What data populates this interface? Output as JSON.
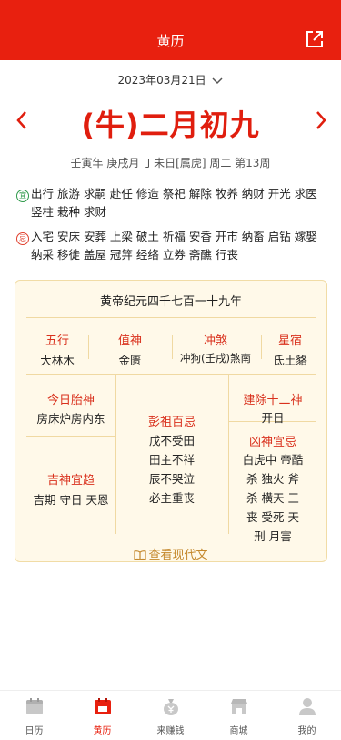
{
  "header": {
    "title": "黄历"
  },
  "date_selector": {
    "text": "2023年03月21日"
  },
  "big_date": "(牛)二月初九",
  "sub_date": "壬寅年 庚戌月 丁未日[属虎] 周二 第13周",
  "yi": {
    "badge": "宜",
    "text": "出行 旅游 求嗣 赴任 修造 祭祀 解除 牧养 纳财 开光 求医 竖柱 栽种 求财"
  },
  "ji": {
    "badge": "忌",
    "text": "入宅 安床 安葬 上梁 破土 祈福 安香 开市 纳畜 启钻 嫁娶 纳采 移徙 盖屋 冠笄 经络 立券 斋醮 行丧"
  },
  "card": {
    "era": "黄帝纪元四千七百一十九年",
    "row1": [
      {
        "label": "五行",
        "value": "大林木"
      },
      {
        "label": "值神",
        "value": "金匮"
      },
      {
        "label": "冲煞",
        "value": "冲狗(壬戌)煞南"
      },
      {
        "label": "星宿",
        "value": "氐土貉"
      }
    ],
    "taishen": {
      "label": "今日胎神",
      "value": "房床炉房内东"
    },
    "jishen": {
      "label": "吉神宜趋",
      "value": "吉期 守日 天恩"
    },
    "pengzu": {
      "label": "彭祖百忌",
      "lines": [
        "戊不受田",
        "田主不祥",
        "辰不哭泣",
        "必主重丧"
      ]
    },
    "jianchu": {
      "label": "建除十二神",
      "value": "开日"
    },
    "xiongshen": {
      "label": "凶神宜忌",
      "lines": [
        "白虎中 帝酷",
        "杀 独火 斧",
        "杀 横天 三",
        "丧 受死 天",
        "刑 月害"
      ]
    },
    "modern_link": "查看现代文"
  },
  "tabs": [
    {
      "label": "日历",
      "icon": "calendar-icon"
    },
    {
      "label": "黄历",
      "icon": "almanac-icon",
      "active": true
    },
    {
      "label": "来赚钱",
      "icon": "money-bag-icon"
    },
    {
      "label": "商城",
      "icon": "shop-icon"
    },
    {
      "label": "我的",
      "icon": "profile-icon"
    }
  ],
  "colors": {
    "brand": "#e8200f",
    "label_red": "#d9311d",
    "card_bg": "#fff9e9",
    "link_gold": "#c4882c"
  }
}
